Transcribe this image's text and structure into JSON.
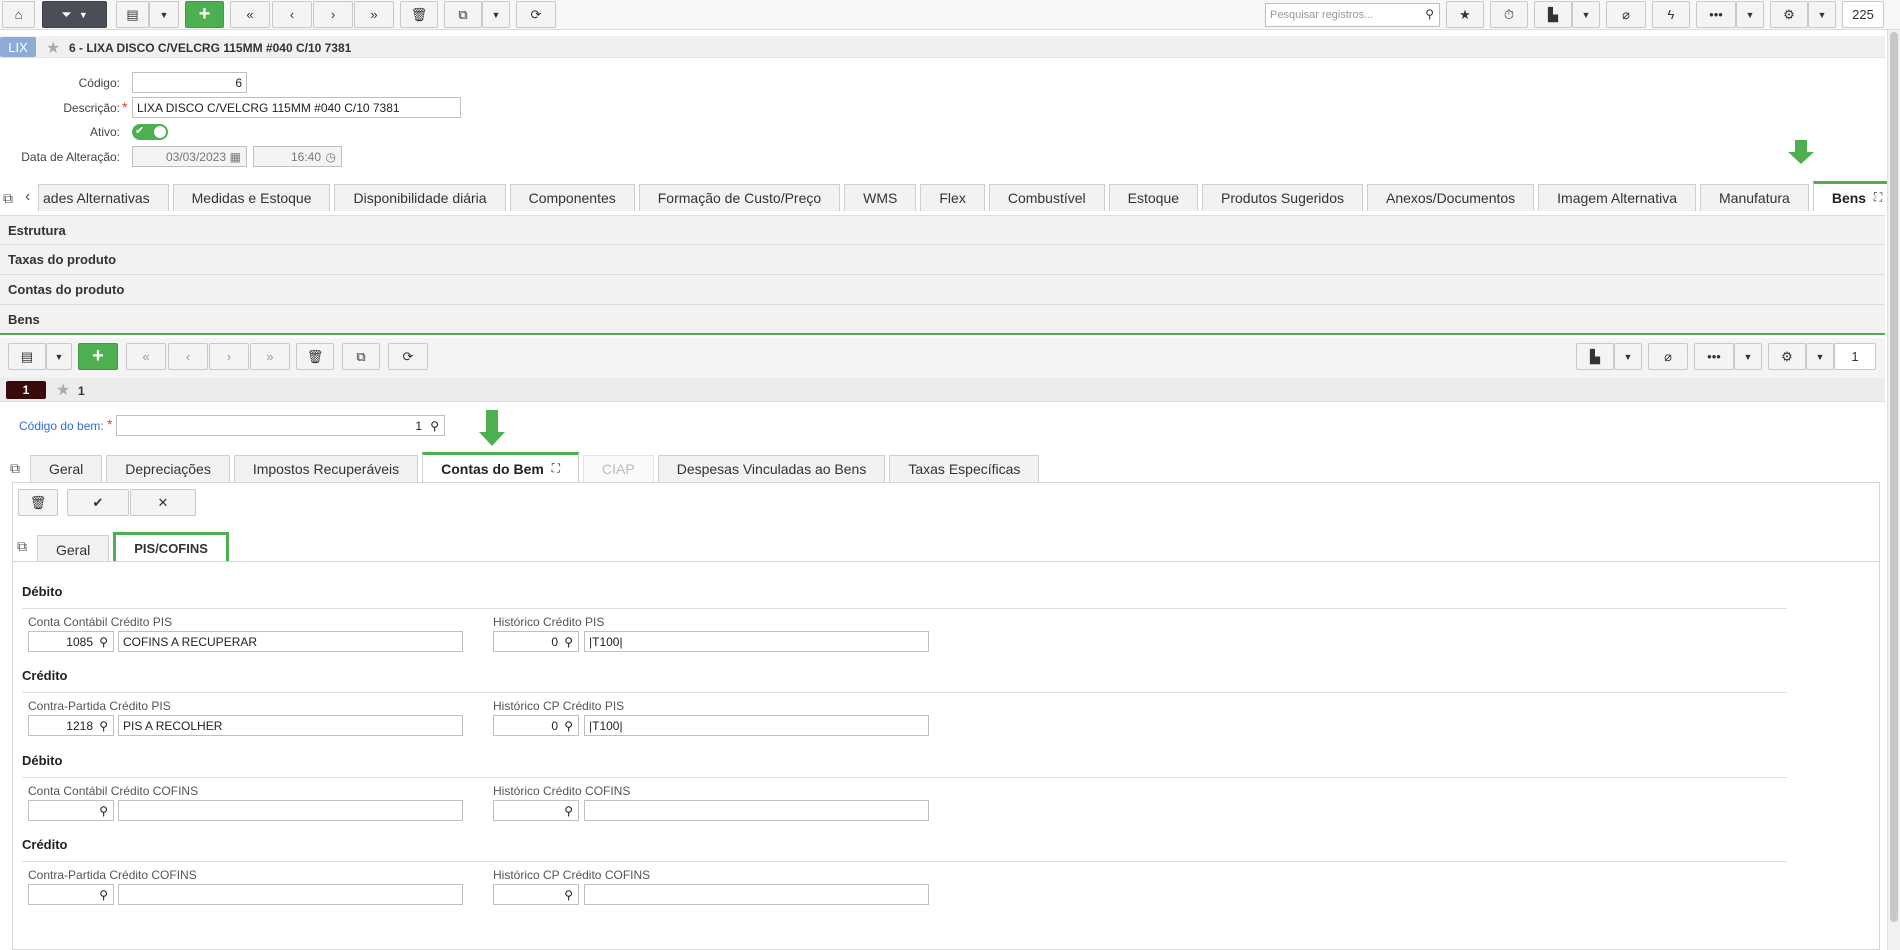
{
  "toolbar": {
    "search_placeholder": "Pesquisar registros...",
    "record_count": "225"
  },
  "record": {
    "badge": "LIX",
    "title": "6 - LIXA DISCO C/VELCRG 115MM #040 C/10 7381"
  },
  "form": {
    "codigo_label": "Código:",
    "codigo_value": "6",
    "descricao_label": "Descrição:",
    "descricao_value": "LIXA DISCO C/VELCRG 115MM #040 C/10 7381",
    "ativo_label": "Ativo:",
    "data_label": "Data de Alteração:",
    "data_value": "03/03/2023",
    "hora_value": "16:40"
  },
  "main_tabs": [
    "ades Alternativas",
    "Medidas e Estoque",
    "Disponibilidade diária",
    "Componentes",
    "Formação de Custo/Preço",
    "WMS",
    "Flex",
    "Combustível",
    "Estoque",
    "Produtos Sugeridos",
    "Anexos/Documentos",
    "Imagem Alternativa",
    "Manufatura",
    "Bens"
  ],
  "sections": [
    "Estrutura",
    "Taxas do produto",
    "Contas do produto",
    "Bens"
  ],
  "sub_toolbar": {
    "count": "1"
  },
  "sub_record": {
    "index": "1",
    "label": "1"
  },
  "bem": {
    "label": "Código do bem:",
    "value": "1"
  },
  "bem_tabs": [
    "Geral",
    "Depreciações",
    "Impostos Recuperáveis",
    "Contas do Bem",
    "CIAP",
    "Despesas Vinculadas ao Bens",
    "Taxas Específicas"
  ],
  "inner_tabs": [
    "Geral",
    "PIS/COFINS"
  ],
  "groups": {
    "g1": "Débito",
    "g2": "Crédito",
    "g3": "Débito",
    "g4": "Crédito"
  },
  "fields": {
    "f1": {
      "label": "Conta Contábil Crédito PIS",
      "code": "1085",
      "desc": "COFINS A RECUPERAR"
    },
    "h1": {
      "label": "Histórico Crédito PIS",
      "code": "0",
      "desc": "|T100|"
    },
    "f2": {
      "label": "Contra-Partida Crédito PIS",
      "code": "1218",
      "desc": "PIS A RECOLHER"
    },
    "h2": {
      "label": "Histórico CP Crédito PIS",
      "code": "0",
      "desc": "|T100|"
    },
    "f3": {
      "label": "Conta Contábil Crédito COFINS",
      "code": "",
      "desc": ""
    },
    "h3": {
      "label": "Histórico Crédito COFINS",
      "code": "",
      "desc": ""
    },
    "f4": {
      "label": "Contra-Partida Crédito COFINS",
      "code": "",
      "desc": ""
    },
    "h4": {
      "label": "Histórico CP Crédito COFINS",
      "code": "",
      "desc": ""
    }
  },
  "colors": {
    "accent": "#4cb050",
    "badge": "#8fa9d8"
  }
}
